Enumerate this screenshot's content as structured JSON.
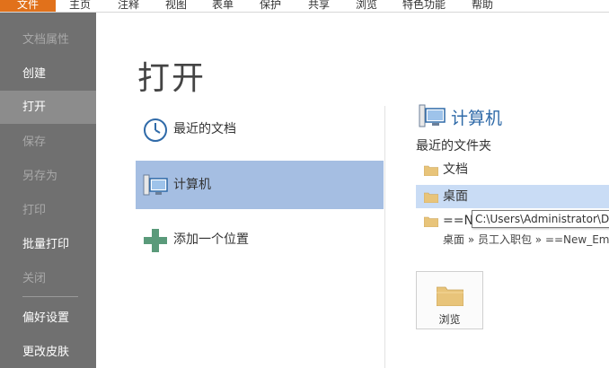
{
  "menu": {
    "items": [
      {
        "label": "文件",
        "active": true
      },
      {
        "label": "主页"
      },
      {
        "label": "注释"
      },
      {
        "label": "视图"
      },
      {
        "label": "表单"
      },
      {
        "label": "保护"
      },
      {
        "label": "共享"
      },
      {
        "label": "浏览"
      },
      {
        "label": "特色功能"
      },
      {
        "label": "帮助"
      }
    ]
  },
  "sidebar": {
    "items": [
      {
        "label": "文档属性",
        "enabled": false
      },
      {
        "label": "创建",
        "enabled": true
      },
      {
        "label": "打开",
        "enabled": true,
        "selected": true
      },
      {
        "label": "保存",
        "enabled": false
      },
      {
        "label": "另存为",
        "enabled": false
      },
      {
        "label": "打印",
        "enabled": false
      },
      {
        "label": "批量打印",
        "enabled": true
      },
      {
        "label": "关闭",
        "enabled": false
      },
      {
        "label": "偏好设置",
        "enabled": true
      },
      {
        "label": "更改皮肤",
        "enabled": true
      }
    ]
  },
  "page_title": "打开",
  "locations": {
    "recent_docs": "最近的文档",
    "computer": "计算机",
    "add_location": "添加一个位置"
  },
  "right_panel": {
    "title": "计算机",
    "recent_folders_label": "最近的文件夹",
    "folders": [
      {
        "label": "文档"
      },
      {
        "label": "桌面",
        "selected": true
      },
      {
        "label": "==N"
      }
    ],
    "path": "桌面 » 员工入职包 » ==New_Emp",
    "tooltip": "C:\\Users\\Administrator\\De",
    "browse_label": "浏览"
  },
  "colors": {
    "accent_orange": "#e1711b",
    "sidebar_bg": "#707070",
    "selection_blue": "#a5bee2",
    "title_blue": "#2f6aa8",
    "add_green": "#5a9a7a",
    "folder_tan": "#e8c47a"
  }
}
